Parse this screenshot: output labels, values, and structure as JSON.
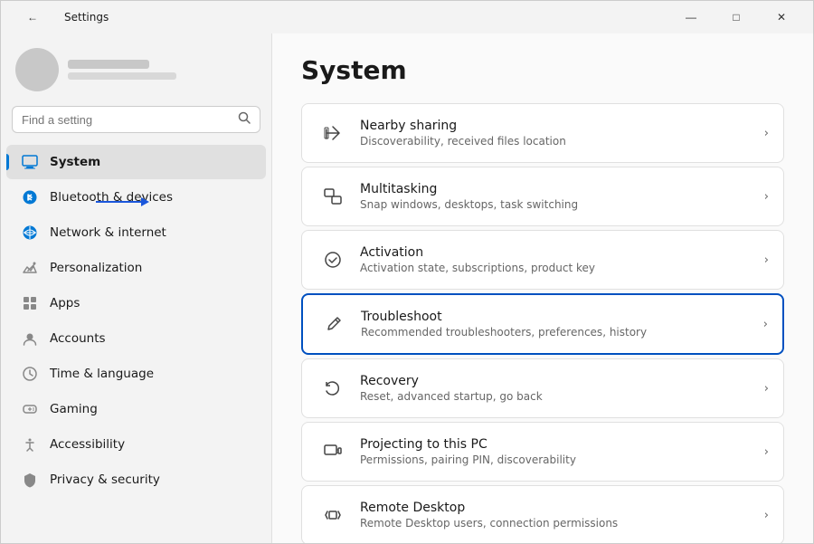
{
  "titlebar": {
    "title": "Settings",
    "back_icon": "←",
    "min_label": "—",
    "max_label": "□",
    "close_label": "✕"
  },
  "sidebar": {
    "search_placeholder": "Find a setting",
    "search_icon": "🔍",
    "nav_items": [
      {
        "id": "system",
        "label": "System",
        "icon": "system",
        "active": true
      },
      {
        "id": "bluetooth",
        "label": "Bluetooth & devices",
        "icon": "bluetooth",
        "active": false
      },
      {
        "id": "network",
        "label": "Network & internet",
        "icon": "network",
        "active": false
      },
      {
        "id": "personalization",
        "label": "Personalization",
        "icon": "personalization",
        "active": false
      },
      {
        "id": "apps",
        "label": "Apps",
        "icon": "apps",
        "active": false
      },
      {
        "id": "accounts",
        "label": "Accounts",
        "icon": "accounts",
        "active": false
      },
      {
        "id": "time",
        "label": "Time & language",
        "icon": "time",
        "active": false
      },
      {
        "id": "gaming",
        "label": "Gaming",
        "icon": "gaming",
        "active": false
      },
      {
        "id": "accessibility",
        "label": "Accessibility",
        "icon": "accessibility",
        "active": false
      },
      {
        "id": "privacy",
        "label": "Privacy & security",
        "icon": "privacy",
        "active": false
      }
    ]
  },
  "main": {
    "title": "System",
    "settings_items": [
      {
        "id": "nearby-sharing",
        "icon": "nearby",
        "title": "Nearby sharing",
        "description": "Discoverability, received files location",
        "highlighted": false
      },
      {
        "id": "multitasking",
        "icon": "multitasking",
        "title": "Multitasking",
        "description": "Snap windows, desktops, task switching",
        "highlighted": false
      },
      {
        "id": "activation",
        "icon": "activation",
        "title": "Activation",
        "description": "Activation state, subscriptions, product key",
        "highlighted": false
      },
      {
        "id": "troubleshoot",
        "icon": "troubleshoot",
        "title": "Troubleshoot",
        "description": "Recommended troubleshooters, preferences, history",
        "highlighted": true
      },
      {
        "id": "recovery",
        "icon": "recovery",
        "title": "Recovery",
        "description": "Reset, advanced startup, go back",
        "highlighted": false
      },
      {
        "id": "projecting",
        "icon": "projecting",
        "title": "Projecting to this PC",
        "description": "Permissions, pairing PIN, discoverability",
        "highlighted": false
      },
      {
        "id": "remote-desktop",
        "icon": "remote",
        "title": "Remote Desktop",
        "description": "Remote Desktop users, connection permissions",
        "highlighted": false
      }
    ]
  }
}
